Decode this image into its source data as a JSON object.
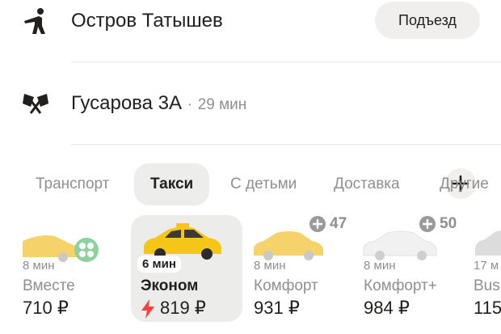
{
  "route": {
    "from": {
      "address": "Остров Татышев",
      "entrance_label": "Подъезд"
    },
    "to": {
      "address": "Гусарова 3А",
      "eta": "29 мин",
      "separator": "·"
    }
  },
  "tabs": [
    {
      "label": "Транспорт",
      "active": false
    },
    {
      "label": "Такси",
      "active": true
    },
    {
      "label": "С детьми",
      "active": false
    },
    {
      "label": "Доставка",
      "active": false
    },
    {
      "label": "Другие",
      "active": false
    }
  ],
  "tariffs": [
    {
      "name": "Вместе",
      "eta": "8 мин",
      "price": "710 ₽",
      "selected": false,
      "bonus": ""
    },
    {
      "name": "Эконом",
      "eta": "6 мин",
      "price": "819 ₽",
      "selected": true,
      "bonus": "",
      "surge": "⚡"
    },
    {
      "name": "Комфорт",
      "eta": "8 мин",
      "price": "931 ₽",
      "selected": false,
      "bonus": "47"
    },
    {
      "name": "Комфорт+",
      "eta": "8 мин",
      "price": "984 ₽",
      "selected": false,
      "bonus": "50"
    },
    {
      "name": "Bus",
      "eta": "17 м",
      "price": "115",
      "selected": false,
      "bonus": ""
    }
  ],
  "colors": {
    "taxi_yellow": "#f5c518",
    "surge_red": "#f5413d",
    "bonus_gray": "#9a9a9a"
  }
}
